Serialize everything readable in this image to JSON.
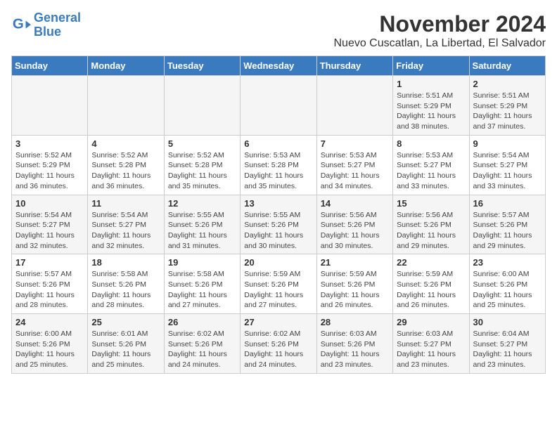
{
  "logo": {
    "line1": "General",
    "line2": "Blue"
  },
  "title": "November 2024",
  "subtitle": "Nuevo Cuscatlan, La Libertad, El Salvador",
  "days_of_week": [
    "Sunday",
    "Monday",
    "Tuesday",
    "Wednesday",
    "Thursday",
    "Friday",
    "Saturday"
  ],
  "weeks": [
    [
      {
        "day": "",
        "info": ""
      },
      {
        "day": "",
        "info": ""
      },
      {
        "day": "",
        "info": ""
      },
      {
        "day": "",
        "info": ""
      },
      {
        "day": "",
        "info": ""
      },
      {
        "day": "1",
        "info": "Sunrise: 5:51 AM\nSunset: 5:29 PM\nDaylight: 11 hours\nand 38 minutes."
      },
      {
        "day": "2",
        "info": "Sunrise: 5:51 AM\nSunset: 5:29 PM\nDaylight: 11 hours\nand 37 minutes."
      }
    ],
    [
      {
        "day": "3",
        "info": "Sunrise: 5:52 AM\nSunset: 5:29 PM\nDaylight: 11 hours\nand 36 minutes."
      },
      {
        "day": "4",
        "info": "Sunrise: 5:52 AM\nSunset: 5:28 PM\nDaylight: 11 hours\nand 36 minutes."
      },
      {
        "day": "5",
        "info": "Sunrise: 5:52 AM\nSunset: 5:28 PM\nDaylight: 11 hours\nand 35 minutes."
      },
      {
        "day": "6",
        "info": "Sunrise: 5:53 AM\nSunset: 5:28 PM\nDaylight: 11 hours\nand 35 minutes."
      },
      {
        "day": "7",
        "info": "Sunrise: 5:53 AM\nSunset: 5:27 PM\nDaylight: 11 hours\nand 34 minutes."
      },
      {
        "day": "8",
        "info": "Sunrise: 5:53 AM\nSunset: 5:27 PM\nDaylight: 11 hours\nand 33 minutes."
      },
      {
        "day": "9",
        "info": "Sunrise: 5:54 AM\nSunset: 5:27 PM\nDaylight: 11 hours\nand 33 minutes."
      }
    ],
    [
      {
        "day": "10",
        "info": "Sunrise: 5:54 AM\nSunset: 5:27 PM\nDaylight: 11 hours\nand 32 minutes."
      },
      {
        "day": "11",
        "info": "Sunrise: 5:54 AM\nSunset: 5:27 PM\nDaylight: 11 hours\nand 32 minutes."
      },
      {
        "day": "12",
        "info": "Sunrise: 5:55 AM\nSunset: 5:26 PM\nDaylight: 11 hours\nand 31 minutes."
      },
      {
        "day": "13",
        "info": "Sunrise: 5:55 AM\nSunset: 5:26 PM\nDaylight: 11 hours\nand 30 minutes."
      },
      {
        "day": "14",
        "info": "Sunrise: 5:56 AM\nSunset: 5:26 PM\nDaylight: 11 hours\nand 30 minutes."
      },
      {
        "day": "15",
        "info": "Sunrise: 5:56 AM\nSunset: 5:26 PM\nDaylight: 11 hours\nand 29 minutes."
      },
      {
        "day": "16",
        "info": "Sunrise: 5:57 AM\nSunset: 5:26 PM\nDaylight: 11 hours\nand 29 minutes."
      }
    ],
    [
      {
        "day": "17",
        "info": "Sunrise: 5:57 AM\nSunset: 5:26 PM\nDaylight: 11 hours\nand 28 minutes."
      },
      {
        "day": "18",
        "info": "Sunrise: 5:58 AM\nSunset: 5:26 PM\nDaylight: 11 hours\nand 28 minutes."
      },
      {
        "day": "19",
        "info": "Sunrise: 5:58 AM\nSunset: 5:26 PM\nDaylight: 11 hours\nand 27 minutes."
      },
      {
        "day": "20",
        "info": "Sunrise: 5:59 AM\nSunset: 5:26 PM\nDaylight: 11 hours\nand 27 minutes."
      },
      {
        "day": "21",
        "info": "Sunrise: 5:59 AM\nSunset: 5:26 PM\nDaylight: 11 hours\nand 26 minutes."
      },
      {
        "day": "22",
        "info": "Sunrise: 5:59 AM\nSunset: 5:26 PM\nDaylight: 11 hours\nand 26 minutes."
      },
      {
        "day": "23",
        "info": "Sunrise: 6:00 AM\nSunset: 5:26 PM\nDaylight: 11 hours\nand 25 minutes."
      }
    ],
    [
      {
        "day": "24",
        "info": "Sunrise: 6:00 AM\nSunset: 5:26 PM\nDaylight: 11 hours\nand 25 minutes."
      },
      {
        "day": "25",
        "info": "Sunrise: 6:01 AM\nSunset: 5:26 PM\nDaylight: 11 hours\nand 25 minutes."
      },
      {
        "day": "26",
        "info": "Sunrise: 6:02 AM\nSunset: 5:26 PM\nDaylight: 11 hours\nand 24 minutes."
      },
      {
        "day": "27",
        "info": "Sunrise: 6:02 AM\nSunset: 5:26 PM\nDaylight: 11 hours\nand 24 minutes."
      },
      {
        "day": "28",
        "info": "Sunrise: 6:03 AM\nSunset: 5:26 PM\nDaylight: 11 hours\nand 23 minutes."
      },
      {
        "day": "29",
        "info": "Sunrise: 6:03 AM\nSunset: 5:27 PM\nDaylight: 11 hours\nand 23 minutes."
      },
      {
        "day": "30",
        "info": "Sunrise: 6:04 AM\nSunset: 5:27 PM\nDaylight: 11 hours\nand 23 minutes."
      }
    ]
  ]
}
